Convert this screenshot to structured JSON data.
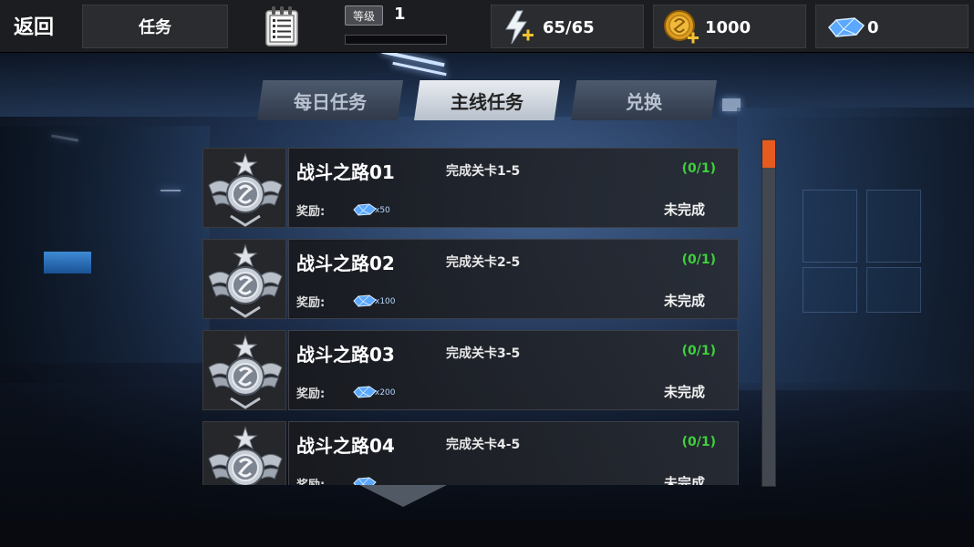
{
  "header": {
    "back_label": "返回",
    "title": "任务",
    "level_tag": "等级",
    "level_value": "1",
    "energy": "65/65",
    "gold": "1000",
    "gems": "0"
  },
  "tabs": [
    {
      "label": "每日任务",
      "active": false
    },
    {
      "label": "主线任务",
      "active": true
    },
    {
      "label": "兑换",
      "active": false
    }
  ],
  "reward_label": "奖励:",
  "quests": [
    {
      "name": "战斗之路01",
      "condition": "完成关卡1-5",
      "progress": "(0/1)",
      "reward": "x50",
      "status": "未完成"
    },
    {
      "name": "战斗之路02",
      "condition": "完成关卡2-5",
      "progress": "(0/1)",
      "reward": "x100",
      "status": "未完成"
    },
    {
      "name": "战斗之路03",
      "condition": "完成关卡3-5",
      "progress": "(0/1)",
      "reward": "x200",
      "status": "未完成"
    },
    {
      "name": "战斗之路04",
      "condition": "完成关卡4-5",
      "progress": "(0/1)",
      "reward": "",
      "status": "未完成"
    }
  ],
  "colors": {
    "progress_green": "#3ed13a",
    "scroll_accent": "#e65b1f",
    "topbar_bg": "#1c1d20"
  },
  "icons": {
    "task": "clipboard-icon",
    "energy": "lightning-plus-icon",
    "gold": "gold-coin-plus-icon",
    "gem": "blue-gem-icon",
    "quest_badge": "winged-star-emblem-icon"
  }
}
